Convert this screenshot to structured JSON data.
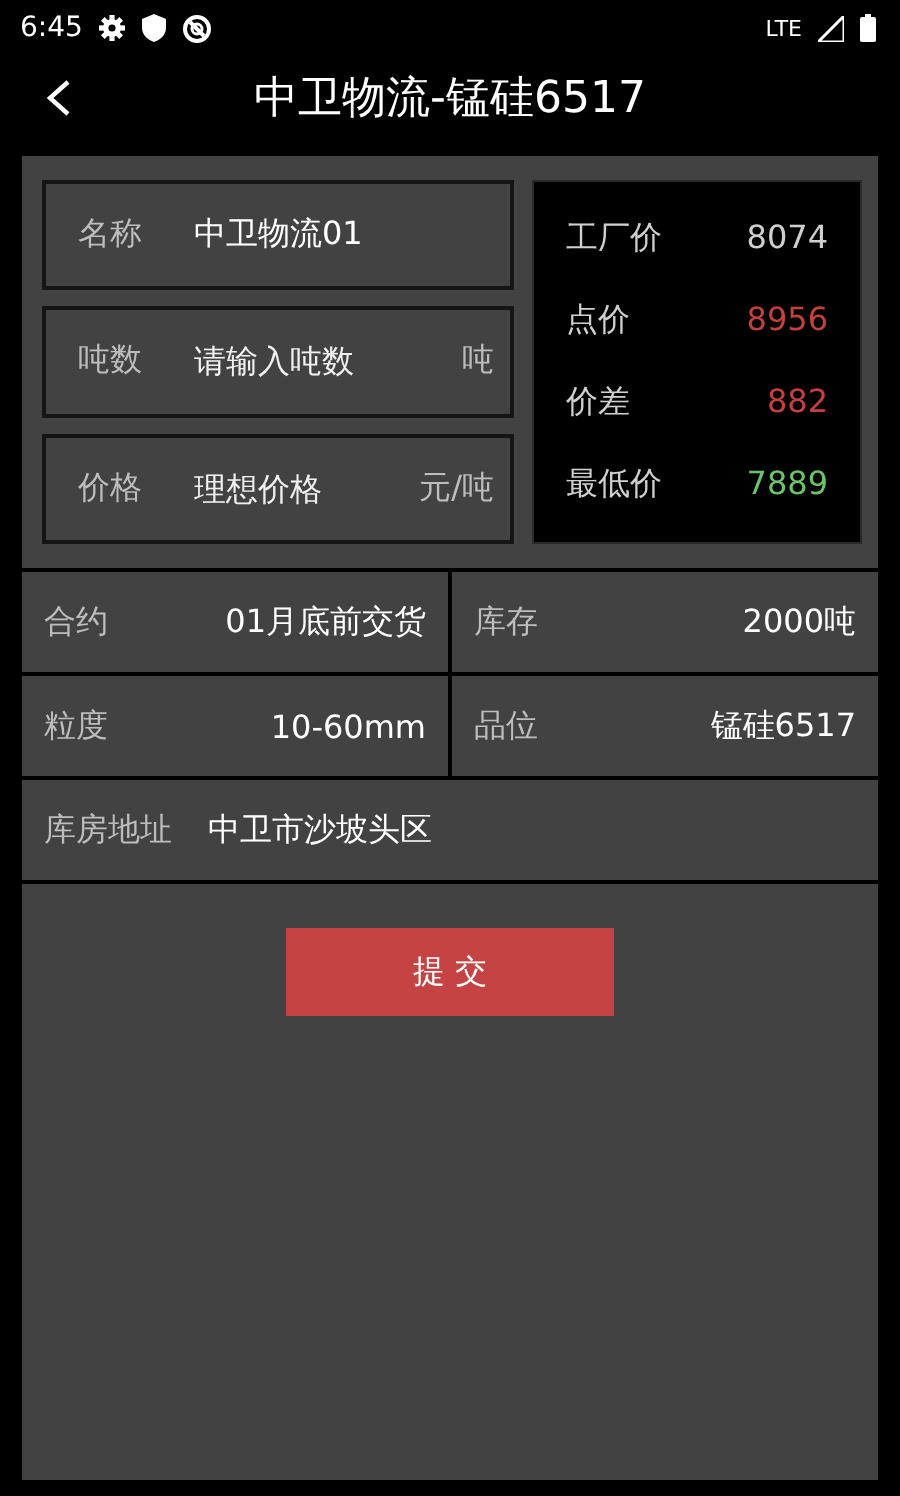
{
  "status_bar": {
    "time": "6:45",
    "network": "LTE"
  },
  "header": {
    "title": "中卫物流-锰硅6517"
  },
  "fields": [
    {
      "label": "名称",
      "value": "中卫物流01"
    },
    {
      "label": "吨数",
      "placeholder": "请输入吨数",
      "unit": "吨"
    },
    {
      "label": "价格",
      "placeholder": "理想价格",
      "unit": "元/吨"
    }
  ],
  "prices": [
    {
      "label": "工厂价",
      "value": "8074",
      "color": "#cfcfcf"
    },
    {
      "label": "点价",
      "value": "8956",
      "color": "#c4403e"
    },
    {
      "label": "价差",
      "value": "882",
      "color": "#c4403e"
    },
    {
      "label": "最低价",
      "value": "7889",
      "color": "#6cc46a"
    }
  ],
  "info_rows": [
    [
      {
        "label": "合约",
        "value": "01月底前交货"
      },
      {
        "label": "库存",
        "value": "2000吨"
      }
    ],
    [
      {
        "label": "粒度",
        "value": "10-60mm"
      },
      {
        "label": "品位",
        "value": "锰硅6517"
      }
    ],
    [
      {
        "label": "库房地址",
        "value": "中卫市沙坡头区"
      }
    ]
  ],
  "submit_button": {
    "label": "提 交"
  }
}
